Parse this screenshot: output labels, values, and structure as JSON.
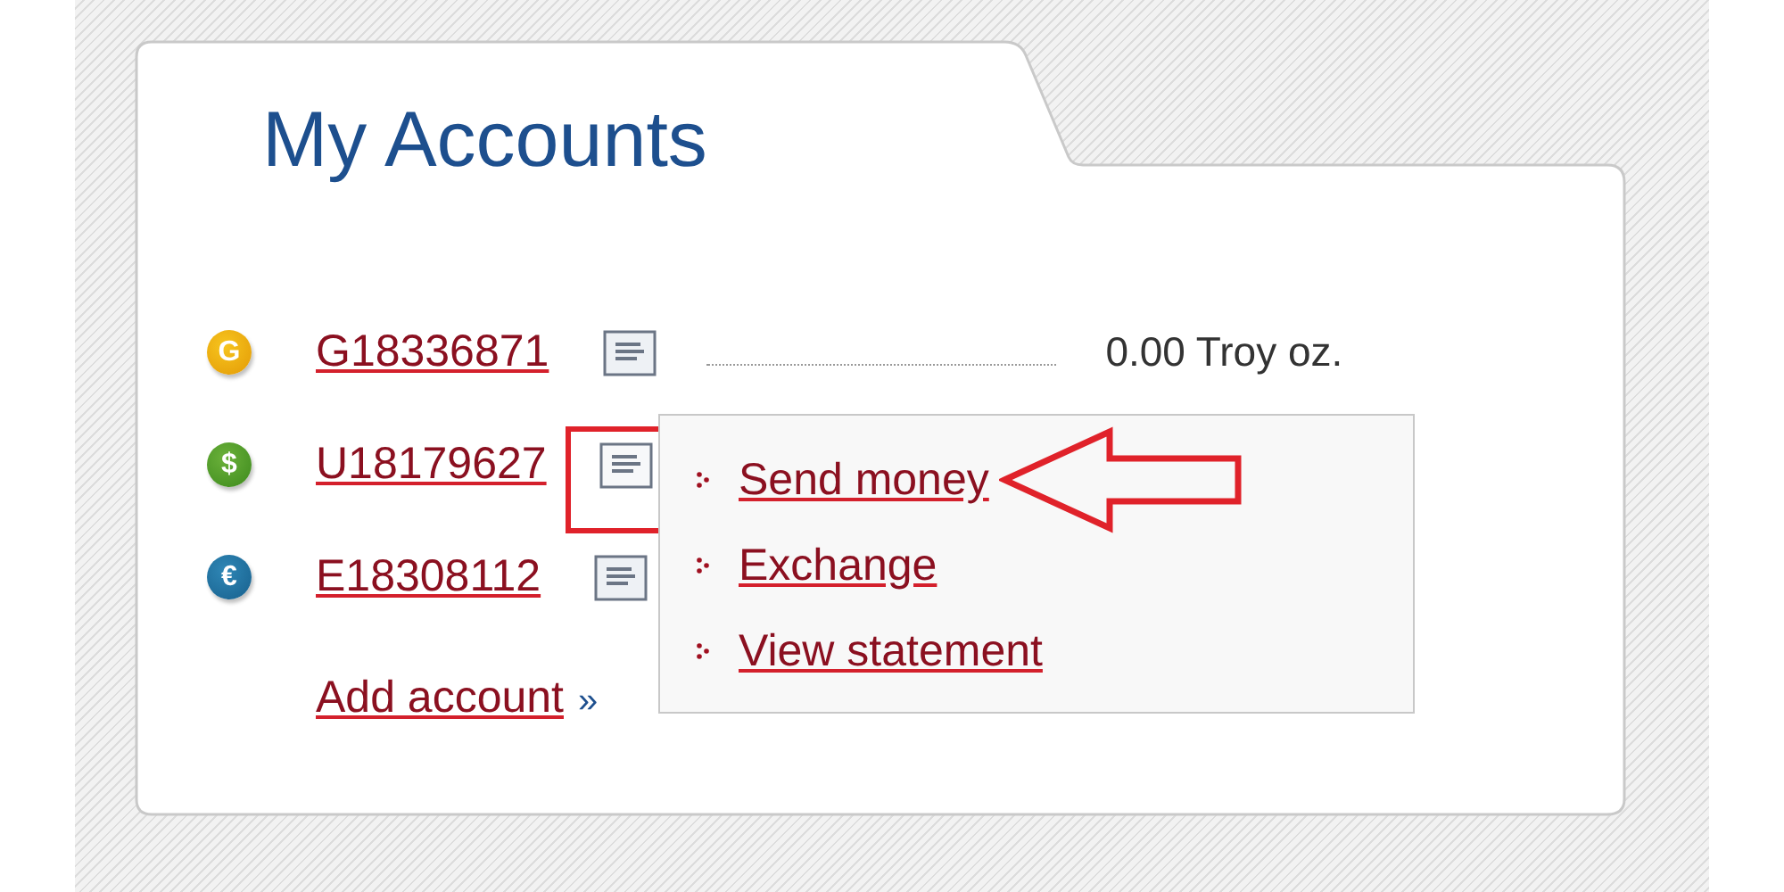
{
  "title": "My Accounts",
  "accounts": [
    {
      "kind": "gold",
      "symbol": "G",
      "number": "G18336871",
      "balance": "0.00 Troy oz.",
      "menu_open": false,
      "highlighted": false
    },
    {
      "kind": "usd",
      "symbol": "$",
      "number": "U18179627",
      "menu_open": true,
      "highlighted": true
    },
    {
      "kind": "eur",
      "symbol": "€",
      "number": "E18308112",
      "menu_open": false,
      "highlighted": false
    }
  ],
  "add_account": {
    "label": "Add account",
    "suffix": "»"
  },
  "menu": {
    "items": [
      {
        "label": "Send money",
        "pointed": true
      },
      {
        "label": "Exchange",
        "pointed": false
      },
      {
        "label": "View statement",
        "pointed": false
      }
    ]
  }
}
